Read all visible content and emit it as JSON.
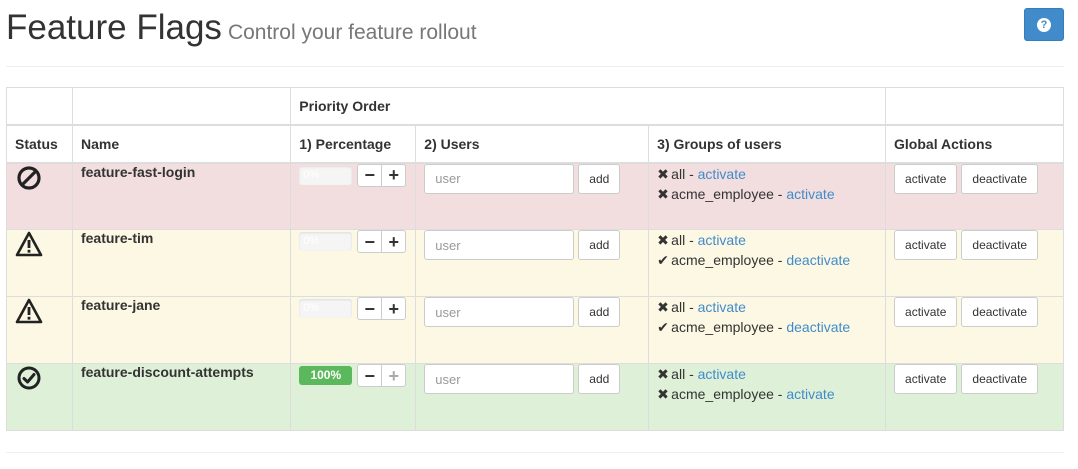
{
  "header": {
    "title": "Feature Flags",
    "subtitle": "Control your feature rollout",
    "help_icon": "question-circle-icon",
    "accent_color": "#428bca"
  },
  "table": {
    "group_header": "Priority Order",
    "columns": {
      "status": "Status",
      "name": "Name",
      "percentage": "1) Percentage",
      "users": "2) Users",
      "groups": "3) Groups of users",
      "global": "Global Actions"
    },
    "rows": [
      {
        "status": "danger",
        "status_icon": "ban-icon",
        "name": "feature-fast-login",
        "percentage": 0,
        "percentage_label": "0%",
        "minus_label": "−",
        "plus_label": "+",
        "user_placeholder": "user",
        "add_label": "add",
        "groups": [
          {
            "mark": "✖",
            "name": "all",
            "sep": " - ",
            "action": "activate"
          },
          {
            "mark": "✖",
            "name": "acme_employee",
            "sep": " - ",
            "action": "activate"
          }
        ],
        "activate_label": "activate",
        "deactivate_label": "deactivate"
      },
      {
        "status": "warning",
        "status_icon": "warning-icon",
        "name": "feature-tim",
        "percentage": 0,
        "percentage_label": "0%",
        "minus_label": "−",
        "plus_label": "+",
        "user_placeholder": "user",
        "add_label": "add",
        "groups": [
          {
            "mark": "✖",
            "name": "all",
            "sep": " - ",
            "action": "activate"
          },
          {
            "mark": "✔",
            "name": "acme_employee",
            "sep": " - ",
            "action": "deactivate"
          }
        ],
        "activate_label": "activate",
        "deactivate_label": "deactivate"
      },
      {
        "status": "warning",
        "status_icon": "warning-icon",
        "name": "feature-jane",
        "percentage": 0,
        "percentage_label": "0%",
        "minus_label": "−",
        "plus_label": "+",
        "user_placeholder": "user",
        "add_label": "add",
        "groups": [
          {
            "mark": "✖",
            "name": "all",
            "sep": " - ",
            "action": "activate"
          },
          {
            "mark": "✔",
            "name": "acme_employee",
            "sep": " - ",
            "action": "deactivate"
          }
        ],
        "activate_label": "activate",
        "deactivate_label": "deactivate"
      },
      {
        "status": "success",
        "status_icon": "check-circle-icon",
        "name": "feature-discount-attempts",
        "percentage": 100,
        "percentage_label": "100%",
        "minus_label": "−",
        "plus_label": "+",
        "user_placeholder": "user",
        "add_label": "add",
        "groups": [
          {
            "mark": "✖",
            "name": "all",
            "sep": " - ",
            "action": "activate"
          },
          {
            "mark": "✖",
            "name": "acme_employee",
            "sep": " - ",
            "action": "activate"
          }
        ],
        "activate_label": "activate",
        "deactivate_label": "deactivate"
      }
    ]
  }
}
